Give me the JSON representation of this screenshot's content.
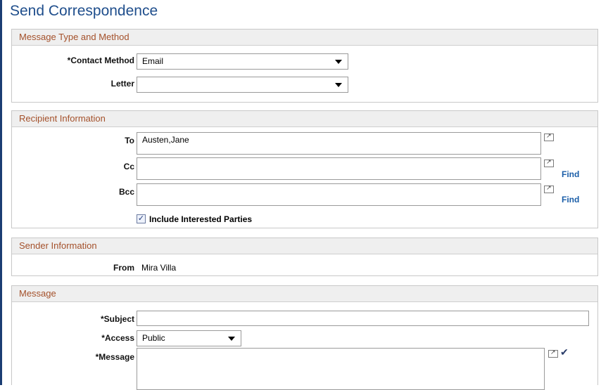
{
  "page": {
    "title": "Send Correspondence"
  },
  "message_type": {
    "heading": "Message Type and Method",
    "contact_method_label": "*Contact Method",
    "contact_method_value": "Email",
    "letter_label": "Letter",
    "letter_value": ""
  },
  "recipient": {
    "heading": "Recipient Information",
    "to_label": "To",
    "to_value": "Austen,Jane",
    "cc_label": "Cc",
    "cc_value": "",
    "bcc_label": "Bcc",
    "bcc_value": "",
    "find_label": "Find",
    "include_label": "Include Interested Parties",
    "include_checked": true
  },
  "sender": {
    "heading": "Sender Information",
    "from_label": "From",
    "from_value": "Mira Villa"
  },
  "message": {
    "heading": "Message",
    "subject_label": "*Subject",
    "subject_value": "",
    "access_label": "*Access",
    "access_value": "Public",
    "message_label": "*Message",
    "message_value": ""
  },
  "icons": {
    "expand": "expand-field-icon",
    "spellcheck": "spell-check-icon"
  },
  "colors": {
    "title": "#1f4e8c",
    "section_heading": "#a4512b",
    "link": "#1b5ea8"
  }
}
